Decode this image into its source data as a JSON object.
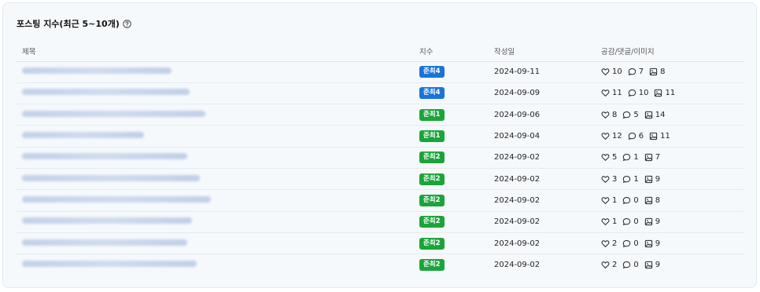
{
  "header": {
    "title": "포스팅 지수(최근 5~10개)"
  },
  "table": {
    "columns": [
      "제목",
      "지수",
      "작성일",
      "공감/댓글/이미지"
    ],
    "rows": [
      {
        "index": "준최4",
        "index_color": "#1a73d9",
        "date": "2024-09-11",
        "likes": "10",
        "comments": "7",
        "images": "8"
      },
      {
        "index": "준최4",
        "index_color": "#1a73d9",
        "date": "2024-09-09",
        "likes": "11",
        "comments": "10",
        "images": "11"
      },
      {
        "index": "준최1",
        "index_color": "#1aa53a",
        "date": "2024-09-06",
        "likes": "8",
        "comments": "5",
        "images": "14"
      },
      {
        "index": "준최1",
        "index_color": "#1aa53a",
        "date": "2024-09-04",
        "likes": "12",
        "comments": "6",
        "images": "11"
      },
      {
        "index": "준최2",
        "index_color": "#1aa53a",
        "date": "2024-09-02",
        "likes": "5",
        "comments": "1",
        "images": "7"
      },
      {
        "index": "준최2",
        "index_color": "#1aa53a",
        "date": "2024-09-02",
        "likes": "3",
        "comments": "1",
        "images": "9"
      },
      {
        "index": "준최2",
        "index_color": "#1aa53a",
        "date": "2024-09-02",
        "likes": "1",
        "comments": "0",
        "images": "8"
      },
      {
        "index": "준최2",
        "index_color": "#1aa53a",
        "date": "2024-09-02",
        "likes": "1",
        "comments": "0",
        "images": "9"
      },
      {
        "index": "준최2",
        "index_color": "#1aa53a",
        "date": "2024-09-02",
        "likes": "2",
        "comments": "0",
        "images": "9"
      },
      {
        "index": "준최2",
        "index_color": "#1aa53a",
        "date": "2024-09-02",
        "likes": "2",
        "comments": "0",
        "images": "9"
      }
    ]
  }
}
